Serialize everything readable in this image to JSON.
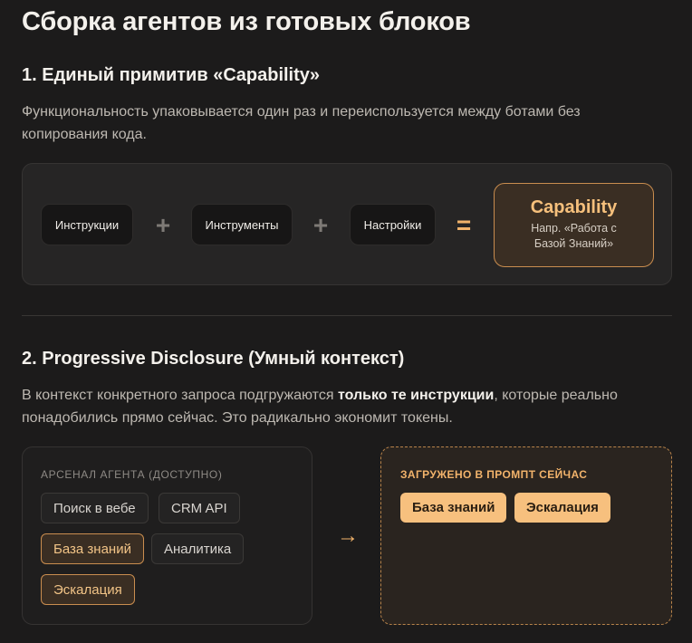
{
  "page": {
    "title": "Сборка агентов из готовых блоков"
  },
  "section1": {
    "title": "1. Единый примитив «Capability»",
    "description": "Функциональность упаковывается один раз и переиспользуется между ботами без копирования кода.",
    "formula": {
      "parts": [
        "Инструкции",
        "Инструменты",
        "Настройки"
      ],
      "plus": "+",
      "equals": "=",
      "result_title": "Capability",
      "result_example": "Напр. «Работа с Базой Знаний»"
    }
  },
  "section2": {
    "title": "2. Progressive Disclosure (Умный контекст)",
    "description_before": "В контекст конкретного запроса подгружаются ",
    "description_bold": "только те инструкции",
    "description_after": ", которые реально понадобились прямо сейчас. Это радикально экономит токены.",
    "arsenal": {
      "label": "АРСЕНАЛ АГЕНТА (ДОСТУПНО)",
      "items": [
        {
          "label": "Поиск в вебе",
          "active": false
        },
        {
          "label": "CRM API",
          "active": false
        },
        {
          "label": "База знаний",
          "active": true
        },
        {
          "label": "Аналитика",
          "active": false
        },
        {
          "label": "Эскалация",
          "active": true
        }
      ]
    },
    "arrow": "→",
    "loaded": {
      "label": "ЗАГРУЖЕНО В ПРОМПТ СЕЙЧАС",
      "items": [
        "База знаний",
        "Эскалация"
      ]
    }
  },
  "colors": {
    "background": "#1c1b1b",
    "accent": "#f2b36b",
    "accent_fill": "#f7c07e",
    "active_chip_bg": "#3a2e23"
  }
}
